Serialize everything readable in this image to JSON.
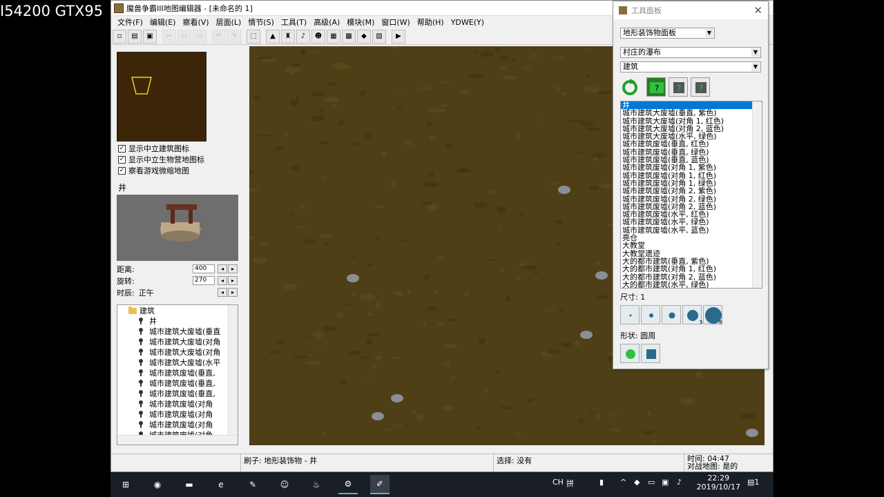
{
  "overlay": {
    "text": "I54200 GTX95"
  },
  "window": {
    "title": "魔兽争霸III地图编辑器 - [未命名的 1]"
  },
  "menu": [
    "文件(F)",
    "编辑(E)",
    "察看(V)",
    "层面(L)",
    "情节(S)",
    "工具(T)",
    "高级(A)",
    "模块(M)",
    "窗口(W)",
    "帮助(H)",
    "YDWE(Y)"
  ],
  "left": {
    "checks": [
      {
        "label": "显示中立建筑图标",
        "checked": true
      },
      {
        "label": "显示中立生物营地图标",
        "checked": true
      },
      {
        "label": "察看游戏微缩地图",
        "checked": true
      }
    ],
    "preview_title": "井",
    "distance_label": "距离:",
    "distance_value": "400",
    "rotation_label": "旋转:",
    "rotation_value": "270",
    "time_label": "时辰:",
    "time_value": "正午",
    "tree": {
      "folder": "建筑",
      "items": [
        "井",
        "城市建筑大废墟(垂直",
        "城市建筑大废墟(对角",
        "城市建筑大废墟(对角",
        "城市建筑大废墟(水平",
        "城市建筑废墟(垂直,",
        "城市建筑废墟(垂直,",
        "城市建筑废墟(垂直,",
        "城市建筑废墟(对角",
        "城市建筑废墟(对角",
        "城市建筑废墟(对角",
        "城市建筑废墟(对角"
      ]
    }
  },
  "status": {
    "brush": "刷子: 地形装饰物 - 井",
    "select": "选择: 没有",
    "time": "时间: 04:47",
    "melee": "对战地图: 是的"
  },
  "tool_panel": {
    "title": "工具面板",
    "close": "✕",
    "panel_select": "地形装饰物面板",
    "tileset_select": "村庄的瀑布",
    "category_select": "建筑",
    "list": [
      "井",
      "城市建筑大废墟(垂直, 紫色)",
      "城市建筑大废墟(对角 1, 红色)",
      "城市建筑大废墟(对角 2, 蓝色)",
      "城市建筑大废墟(水平, 绿色)",
      "城市建筑废墟(垂直, 红色)",
      "城市建筑废墟(垂直, 绿色)",
      "城市建筑废墟(垂直, 蓝色)",
      "城市建筑废墟(对角 1, 紫色)",
      "城市建筑废墟(对角 1, 红色)",
      "城市建筑废墟(对角 1, 绿色)",
      "城市建筑废墟(对角 2, 紫色)",
      "城市建筑废墟(对角 2, 绿色)",
      "城市建筑废墟(对角 2, 蓝色)",
      "城市建筑废墟(水平, 红色)",
      "城市建筑废墟(水平, 绿色)",
      "城市建筑废墟(水平, 蓝色)",
      "亮仓",
      "大教堂",
      "大教堂遗迹",
      "大的都市建筑(垂直, 紫色)",
      "大的都市建筑(对角 1, 红色)",
      "大的都市建筑(对角 2, 蓝色)",
      "大的都市建筑(水平, 绿色)"
    ],
    "size_label": "尺寸: 1",
    "size_badges": [
      "",
      "",
      "",
      "5",
      "8"
    ],
    "shape_label": "形状: 圆周"
  },
  "taskbar": {
    "ime": "CH",
    "ime2": "拼",
    "time": "22:29",
    "date": "2019/10/17",
    "notify": "1"
  }
}
